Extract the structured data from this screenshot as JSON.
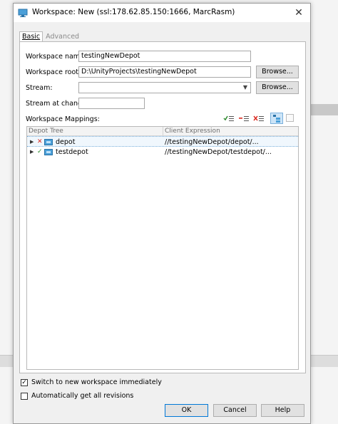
{
  "window": {
    "title": "Workspace: New (ssl:178.62.85.150:1666, MarcRasm)"
  },
  "tabs": [
    {
      "label": "Basic"
    },
    {
      "label": "Advanced"
    }
  ],
  "form": {
    "workspace_name_label": "Workspace name:",
    "workspace_name_value": "testingNewDepot",
    "workspace_root_label": "Workspace root:",
    "workspace_root_value": "D:\\UnityProjects\\testingNewDepot",
    "browse_label": "Browse...",
    "stream_label": "Stream:",
    "stream_value": "",
    "stream_browse_label": "Browse...",
    "stream_at_change_label": "Stream at change:",
    "stream_at_change_value": "",
    "mappings_label": "Workspace Mappings:"
  },
  "mappings": {
    "col_depot_tree": "Depot Tree",
    "col_client_expression": "Client Expression",
    "rows": [
      {
        "mark": "✕",
        "mark_color": "#d9261c",
        "name": "depot",
        "expression": "//testingNewDepot/depot/..."
      },
      {
        "mark": "✓",
        "mark_color": "#2e8b2e",
        "name": "testdepot",
        "expression": "//testingNewDepot/testdepot/..."
      }
    ]
  },
  "options": {
    "switch_label": "Switch to new workspace immediately",
    "switch_checked": true,
    "auto_get_label": "Automatically get all revisions",
    "auto_get_checked": false
  },
  "buttons": {
    "ok": "OK",
    "cancel": "Cancel",
    "help": "Help"
  },
  "colors": {
    "accent": "#0078d7",
    "include": "#2e8b2e",
    "exclude": "#d9261c"
  }
}
